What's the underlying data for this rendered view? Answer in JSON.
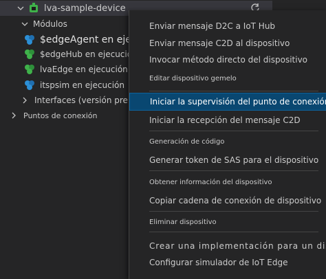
{
  "tree": {
    "device": {
      "label": "lva-sample-device"
    },
    "modules_label": "Módulos",
    "modules": [
      {
        "label": "$edgeAgent en ejecución",
        "color": "#2c8fd6"
      },
      {
        "label": "$edgeHub en ejecución",
        "color": "#3fb24a"
      },
      {
        "label": "lvaEdge en ejecución",
        "color": "#3fb24a"
      },
      {
        "label": "itspsim en ejecución",
        "color": "#2c8fd6"
      }
    ],
    "interfaces_label": "Interfaces (versión preliminar)",
    "endpoints_label": "Puntos de conexión"
  },
  "context_menu": {
    "items": [
      {
        "label": "Enviar mensaje D2C a IoT Hub"
      },
      {
        "label": "Enviar mensaje C2D al dispositivo"
      },
      {
        "label": "Invocar método directo del dispositivo"
      },
      {
        "label": "Editar dispositivo gemelo"
      },
      {
        "label": "Iniciar la supervisión del punto de conexión"
      },
      {
        "label": "Iniciar la recepción del mensaje C2D"
      },
      {
        "label": "Generación de código"
      },
      {
        "label": "Generar token de SAS para el dispositivo"
      },
      {
        "label": "Obtener información del dispositivo"
      },
      {
        "label": "Copiar cadena de conexión de dispositivo"
      },
      {
        "label": "Eliminar dispositivo"
      },
      {
        "label": "Crear una implementación para un dispositivo"
      },
      {
        "label": "Configurar simulador de IoT Edge"
      }
    ]
  }
}
